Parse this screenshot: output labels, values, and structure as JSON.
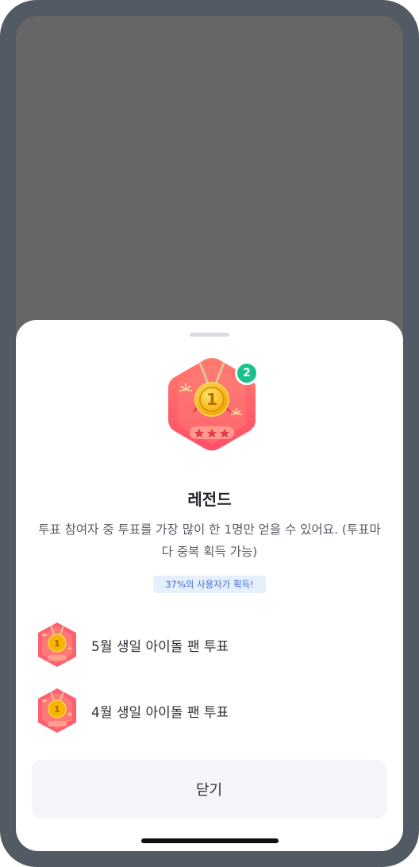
{
  "badge": {
    "count": "2",
    "title": "레전드",
    "description": "투표 참여자 중 투표를 가장 많이 한 1명만 얻을 수 있어요. (투표마다 중복 획득 가능)",
    "acquired_rate": "37%의 사용자가 획득!"
  },
  "votes": [
    {
      "label": "5월 생일 아이돌 팬 투표",
      "icon": "legend-medal-icon"
    },
    {
      "label": "4월 생일 아이돌 팬 투표",
      "icon": "legend-medal-icon"
    }
  ],
  "close_label": "닫기",
  "colors": {
    "frame": "#525a63",
    "dim_overlay": "#666666",
    "badge_accent": "#ff5f6d",
    "medal_gold": "#f5b400",
    "count_badge": "#19c28a",
    "chip_bg": "#e6f0fd",
    "chip_text": "#3c6fc9",
    "button_bg": "#f3f5f9"
  }
}
